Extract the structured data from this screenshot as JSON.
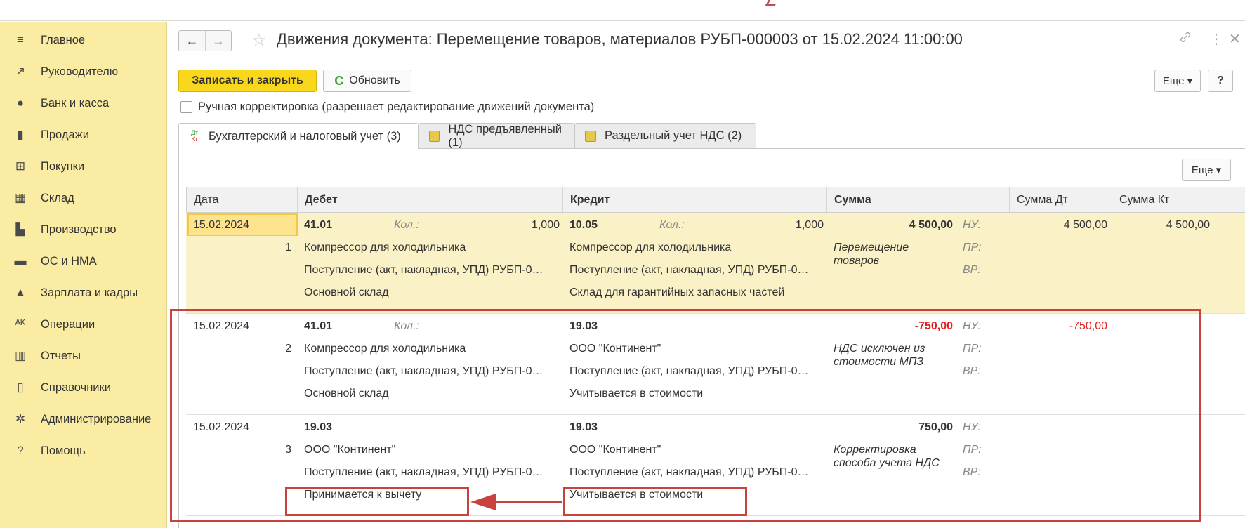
{
  "sidebar": {
    "items": [
      {
        "label": "Главное",
        "icon": "menu-icon",
        "glyph": "≡"
      },
      {
        "label": "Руководителю",
        "icon": "trend-icon",
        "glyph": "↗"
      },
      {
        "label": "Банк и касса",
        "icon": "coin-icon",
        "glyph": "●"
      },
      {
        "label": "Продажи",
        "icon": "bag-icon",
        "glyph": "▮"
      },
      {
        "label": "Покупки",
        "icon": "cart-icon",
        "glyph": "⊞"
      },
      {
        "label": "Склад",
        "icon": "warehouse-icon",
        "glyph": "▦"
      },
      {
        "label": "Производство",
        "icon": "factory-icon",
        "glyph": "▙"
      },
      {
        "label": "ОС и НМА",
        "icon": "truck-icon",
        "glyph": "▬"
      },
      {
        "label": "Зарплата и кадры",
        "icon": "person-icon",
        "glyph": "▲"
      },
      {
        "label": "Операции",
        "icon": "dt-kt-icon",
        "glyph": "ᴬᴷ"
      },
      {
        "label": "Отчеты",
        "icon": "bar-chart-icon",
        "glyph": "▥"
      },
      {
        "label": "Справочники",
        "icon": "book-icon",
        "glyph": "▯"
      },
      {
        "label": "Администрирование",
        "icon": "gear-icon",
        "glyph": "✲"
      },
      {
        "label": "Помощь",
        "icon": "help-icon",
        "glyph": "?"
      }
    ]
  },
  "header": {
    "title": "Движения документа: Перемещение товаров, материалов РУБП-000003 от 15.02.2024 11:00:00",
    "back": "←",
    "forward": "→",
    "star": "☆",
    "link": "🔗",
    "more": "⋮",
    "close": "✕"
  },
  "toolbar": {
    "save_close": "Записать и закрыть",
    "refresh_icon": "C",
    "refresh": "Обновить",
    "more": "Еще ▾",
    "help": "?"
  },
  "manual_edit": {
    "label": "Ручная корректировка (разрешает редактирование движений документа)",
    "checked": false
  },
  "tabs": [
    {
      "label": "Бухгалтерский и налоговый учет (3)",
      "icon": "dt-kt-icon",
      "active": true
    },
    {
      "label": "НДС предъявленный (1)",
      "icon": "register-icon",
      "active": false
    },
    {
      "label": "Раздельный учет НДС (2)",
      "icon": "register-icon",
      "active": false
    }
  ],
  "panel": {
    "more": "Еще ▾"
  },
  "table": {
    "headers": {
      "date": "Дата",
      "debit": "Дебет",
      "credit": "Кредит",
      "sum": "Сумма",
      "blank": "",
      "sum_dt": "Сумма Дт",
      "sum_kt": "Сумма Кт"
    },
    "rows": [
      {
        "date": "15.02.2024",
        "num": "1",
        "debit_account": "41.01",
        "debit_qty_label": "Кол.:",
        "debit_qty": "1,000",
        "debit_sub1": "Компрессор для холодильника",
        "debit_sub2": "Поступление (акт, накладная, УПД) РУБП-0…",
        "debit_sub3": "Основной склад",
        "credit_account": "10.05",
        "credit_qty_label": "Кол.:",
        "credit_qty": "1,000",
        "credit_sub1": "Компрессор для холодильника",
        "credit_sub2": "Поступление (акт, накладная, УПД) РУБП-0…",
        "credit_sub3": "Склад для гарантийных запасных частей",
        "sum": "4 500,00",
        "content": "Перемещение товаров",
        "nu": "НУ:",
        "pr": "ПР:",
        "vr": "ВР:",
        "sum_dt": "4 500,00",
        "sum_kt": "4 500,00"
      },
      {
        "date": "15.02.2024",
        "num": "2",
        "debit_account": "41.01",
        "debit_qty_label": "Кол.:",
        "debit_qty": "",
        "debit_sub1": "Компрессор для холодильника",
        "debit_sub2": "Поступление (акт, накладная, УПД) РУБП-0…",
        "debit_sub3": "Основной склад",
        "credit_account": "19.03",
        "credit_qty_label": "",
        "credit_qty": "",
        "credit_sub1": "ООО \"Континент\"",
        "credit_sub2": "Поступление (акт, накладная, УПД) РУБП-0…",
        "credit_sub3": "Учитывается в стоимости",
        "sum": "-750,00",
        "content": "НДС исключен из стоимости МПЗ",
        "nu": "НУ:",
        "pr": "ПР:",
        "vr": "ВР:",
        "sum_dt": "-750,00",
        "sum_kt": ""
      },
      {
        "date": "15.02.2024",
        "num": "3",
        "debit_account": "19.03",
        "debit_qty_label": "",
        "debit_qty": "",
        "debit_sub1": "ООО \"Континент\"",
        "debit_sub2": "Поступление (акт, накладная, УПД) РУБП-0…",
        "debit_sub3": "Принимается к вычету",
        "credit_account": "19.03",
        "credit_qty_label": "",
        "credit_qty": "",
        "credit_sub1": "ООО \"Континент\"",
        "credit_sub2": "Поступление (акт, накладная, УПД) РУБП-0…",
        "credit_sub3": "Учитывается в стоимости",
        "sum": "750,00",
        "content": "Корректировка способа учета НДС",
        "nu": "НУ:",
        "pr": "ПР:",
        "vr": "ВР:",
        "sum_dt": "",
        "sum_kt": ""
      }
    ]
  },
  "colors": {
    "sidebar_bg": "#fbeca4",
    "primary_button": "#f9d71c",
    "selected_row": "#fbf1c6",
    "annotation_red": "#c9423d",
    "negative_amount": "#e02020"
  }
}
